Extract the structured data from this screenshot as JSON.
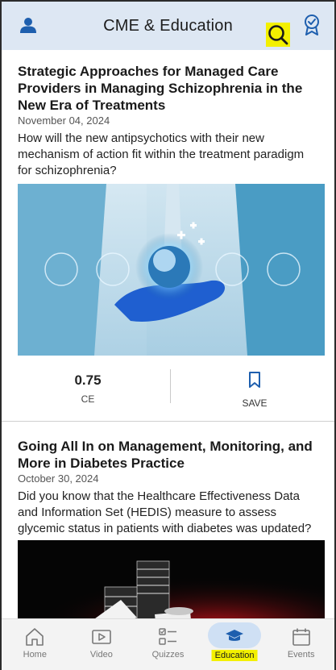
{
  "header": {
    "title": "CME & Education",
    "icons": {
      "profile": "profile-icon",
      "search": "search-icon",
      "badge": "award-badge-icon"
    },
    "accent": "#1e5fae"
  },
  "articles": [
    {
      "title": "Strategic Approaches for Managed Care Providers in Managing Schizophrenia in the New Era of Treatments",
      "date": "November 04, 2024",
      "description": "How will the new antipsychotics with their new mechanism of action fit within the treatment paradigm for schizophrenia?",
      "ce_value": "0.75",
      "ce_label": "CE",
      "save_label": "SAVE"
    },
    {
      "title": "Going All In on Management, Monitoring, and More in Diabetes Practice",
      "date": "October 30, 2024",
      "description": "Did you know that the Healthcare Effectiveness Data and Information Set (HEDIS) measure to assess glycemic status in patients with diabetes was updated?"
    }
  ],
  "nav": {
    "items": [
      {
        "label": "Home",
        "icon": "home-icon"
      },
      {
        "label": "Video",
        "icon": "video-icon"
      },
      {
        "label": "Quizzes",
        "icon": "quizzes-icon"
      },
      {
        "label": "Education",
        "icon": "education-cap-icon",
        "active": true
      },
      {
        "label": "Events",
        "icon": "calendar-icon"
      }
    ]
  }
}
